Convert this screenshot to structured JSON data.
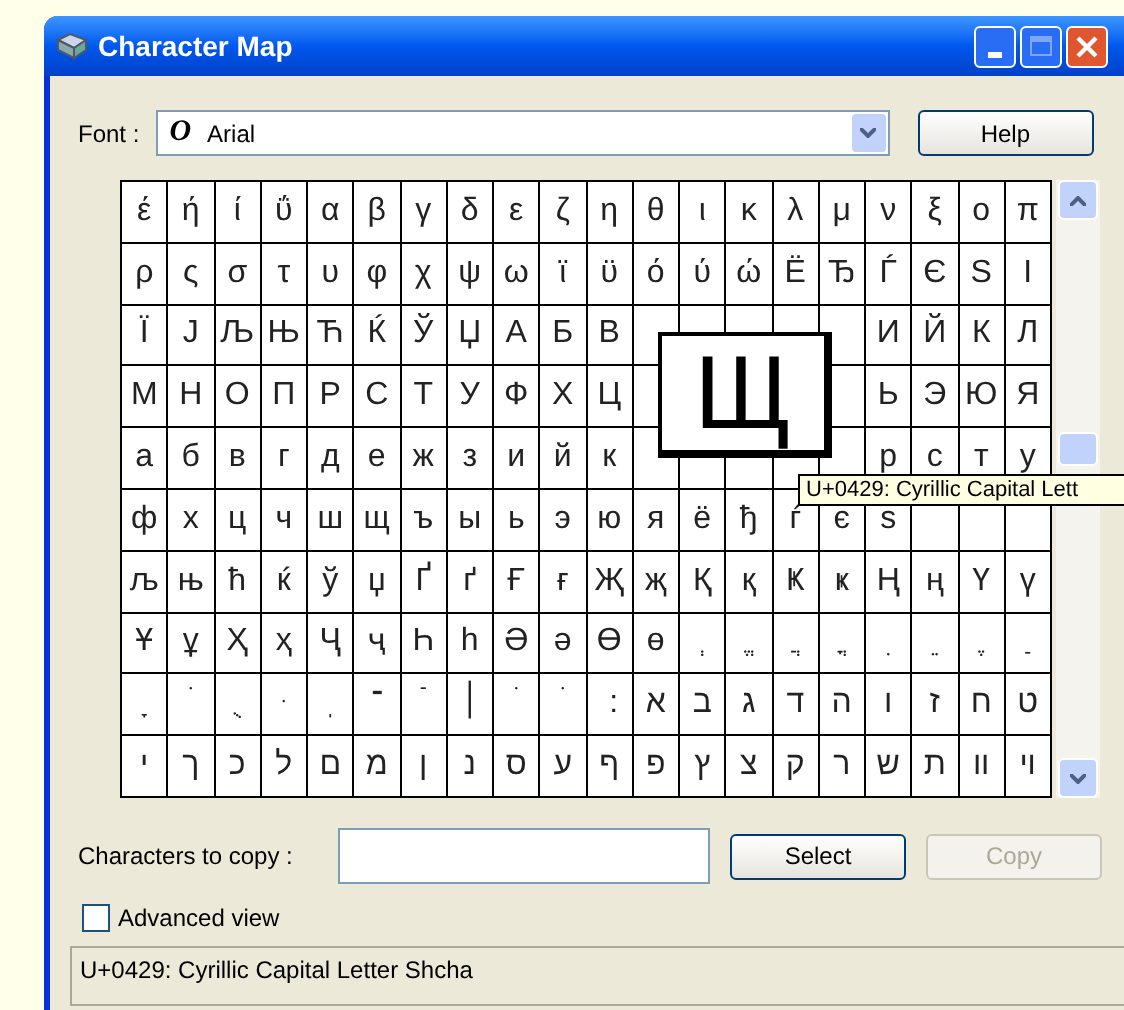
{
  "window": {
    "title": "Character Map"
  },
  "font_field": {
    "label": "Font :",
    "value": "Arial",
    "font_icon": "O"
  },
  "help_button": "Help",
  "grid": {
    "rows": [
      [
        "έ",
        "ή",
        "ί",
        "ΰ",
        "α",
        "β",
        "γ",
        "δ",
        "ε",
        "ζ",
        "η",
        "θ",
        "ι",
        "κ",
        "λ",
        "μ",
        "ν",
        "ξ",
        "ο",
        "π"
      ],
      [
        "ρ",
        "ς",
        "σ",
        "τ",
        "υ",
        "φ",
        "χ",
        "ψ",
        "ω",
        "ϊ",
        "ϋ",
        "ό",
        "ύ",
        "ώ",
        "Ё",
        "Ђ",
        "Ѓ",
        "Є",
        "Ѕ",
        "І"
      ],
      [
        "Ї",
        "Ј",
        "Љ",
        "Њ",
        "Ћ",
        "Ќ",
        "Ў",
        "Џ",
        "А",
        "Б",
        "В",
        null,
        null,
        null,
        null,
        null,
        "И",
        "Й",
        "К",
        "Л"
      ],
      [
        "М",
        "Н",
        "О",
        "П",
        "Р",
        "С",
        "Т",
        "У",
        "Ф",
        "Х",
        "Ц",
        null,
        null,
        null,
        null,
        null,
        "Ь",
        "Э",
        "Ю",
        "Я"
      ],
      [
        "а",
        "б",
        "в",
        "г",
        "д",
        "е",
        "ж",
        "з",
        "и",
        "й",
        "к",
        null,
        null,
        null,
        null,
        null,
        "р",
        "с",
        "т",
        "у"
      ],
      [
        "ф",
        "х",
        "ц",
        "ч",
        "ш",
        "щ",
        "ъ",
        "ы",
        "ь",
        "э",
        "ю",
        "я",
        "ё",
        "ђ",
        "ѓ",
        "є",
        "ѕ",
        null,
        null,
        null
      ],
      [
        "љ",
        "њ",
        "ћ",
        "ќ",
        "ў",
        "џ",
        "Ґ",
        "ґ",
        "Ғ",
        "ғ",
        "Җ",
        "җ",
        "Қ",
        "қ",
        "Ҝ",
        "ҝ",
        "Ң",
        "ң",
        "Ү",
        "ү"
      ],
      [
        "Ұ",
        "ұ",
        "Ҳ",
        "ҳ",
        "Ҷ",
        "ҷ",
        "Һ",
        "һ",
        "Ә",
        "ә",
        "Ө",
        "ө",
        "ְ",
        "ֱ",
        "ֲ",
        "ֳ",
        "ִ",
        "ֵ",
        "ֶ",
        "ַ"
      ],
      [
        "ָ",
        "ֹ",
        "ֻ",
        "ּ",
        "ֽ",
        "־",
        "ֿ",
        "׀",
        "ׁ",
        "ׂ",
        "׃",
        "א",
        "ב",
        "ג",
        "ד",
        "ה",
        "ו",
        "ז",
        "ח",
        "ט"
      ],
      [
        "י",
        "ך",
        "כ",
        "ל",
        "ם",
        "מ",
        "ן",
        "נ",
        "ס",
        "ע",
        "ף",
        "פ",
        "ץ",
        "צ",
        "ק",
        "ר",
        "ש",
        "ת",
        "װ",
        "ױ"
      ]
    ],
    "magnifier": "Щ",
    "tooltip": "U+0429: Cyrillic Capital Lett"
  },
  "copy_field": {
    "label": "Characters to copy :"
  },
  "select_button": {
    "label": "Select",
    "disabled": false
  },
  "copy_button": {
    "label": "Copy",
    "disabled": true
  },
  "advanced_view": {
    "label": "Advanced view",
    "checked": false
  },
  "status_bar": "U+0429: Cyrillic Capital Letter Shcha"
}
